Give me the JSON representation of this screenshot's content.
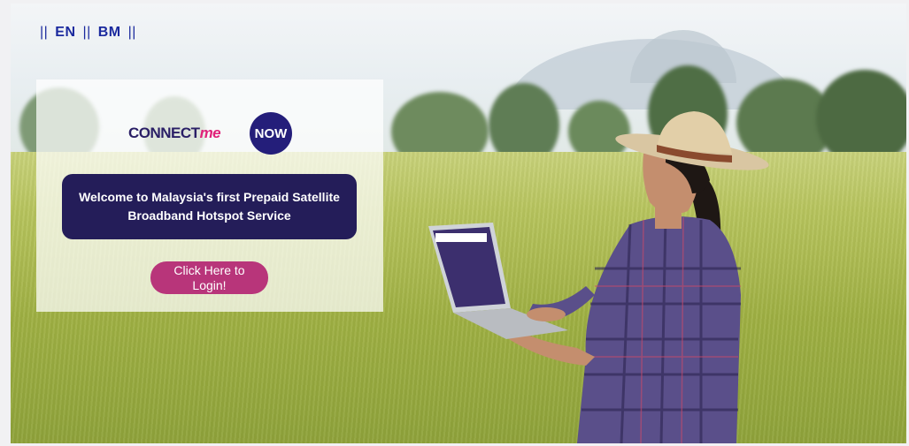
{
  "language_bar": {
    "separator": "||",
    "english_label": "EN",
    "malay_label": "BM"
  },
  "brand": {
    "logo_part1": "CONNECT",
    "logo_part2": "me",
    "logo_part3": "NOW",
    "primary_color": "#241d59",
    "accent_color": "#b8357a"
  },
  "welcome": {
    "line1": "Welcome to Malaysia's first Prepaid Satellite",
    "line2": "Broadband Hotspot Service"
  },
  "login_button": {
    "line1": "Click Here to",
    "line2": "Login!"
  },
  "background": {
    "scene": "rice-field-farmer-with-laptop"
  }
}
